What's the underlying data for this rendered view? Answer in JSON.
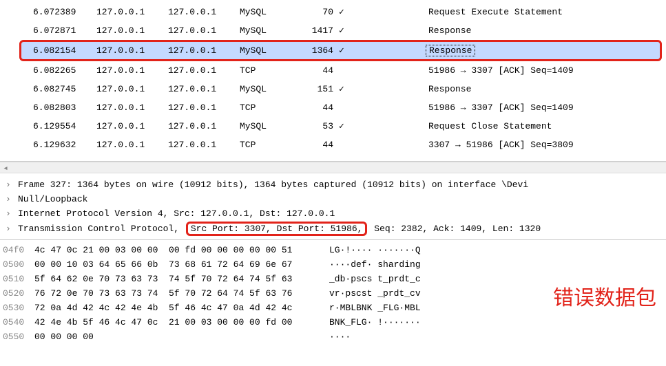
{
  "packets": [
    {
      "time": "6.072389",
      "src": "127.0.0.1",
      "dst": "127.0.0.1",
      "proto": "MySQL",
      "len": "70",
      "check": "✓",
      "info": "Request Execute Statement",
      "highlight": false
    },
    {
      "time": "6.072871",
      "src": "127.0.0.1",
      "dst": "127.0.0.1",
      "proto": "MySQL",
      "len": "1417",
      "check": "✓",
      "info": "Response",
      "highlight": false
    },
    {
      "time": "6.082154",
      "src": "127.0.0.1",
      "dst": "127.0.0.1",
      "proto": "MySQL",
      "len": "1364",
      "check": "✓",
      "info": "Response",
      "highlight": true
    },
    {
      "time": "6.082265",
      "src": "127.0.0.1",
      "dst": "127.0.0.1",
      "proto": "TCP",
      "len": "44",
      "check": "",
      "info": "51986 → 3307 [ACK] Seq=1409",
      "highlight": false
    },
    {
      "time": "6.082745",
      "src": "127.0.0.1",
      "dst": "127.0.0.1",
      "proto": "MySQL",
      "len": "151",
      "check": "✓",
      "info": "Response",
      "highlight": false
    },
    {
      "time": "6.082803",
      "src": "127.0.0.1",
      "dst": "127.0.0.1",
      "proto": "TCP",
      "len": "44",
      "check": "",
      "info": "51986 → 3307 [ACK] Seq=1409",
      "highlight": false
    },
    {
      "time": "6.129554",
      "src": "127.0.0.1",
      "dst": "127.0.0.1",
      "proto": "MySQL",
      "len": "53",
      "check": "✓",
      "info": "Request Close Statement",
      "highlight": false
    },
    {
      "time": "6.129632",
      "src": "127.0.0.1",
      "dst": "127.0.0.1",
      "proto": "TCP",
      "len": "44",
      "check": "",
      "info": "3307 → 51986 [ACK] Seq=3809",
      "highlight": false
    }
  ],
  "details": {
    "frame": "Frame 327: 1364 bytes on wire (10912 bits), 1364 bytes captured (10912 bits) on interface \\Devi",
    "null": "Null/Loopback",
    "ip": "Internet Protocol Version 4, Src: 127.0.0.1, Dst: 127.0.0.1",
    "tcp_pre": "Transmission Control Protocol, ",
    "tcp_box": "Src Port: 3307, Dst Port: 51986,",
    "tcp_post": " Seq: 2382, Ack: 1409, Len: 1320"
  },
  "hex": [
    {
      "off": "04f0",
      "bytes": "4c 47 0c 21 00 03 00 00  00 fd 00 00 00 00 00 51",
      "ascii": "LG·!···· ·······Q"
    },
    {
      "off": "0500",
      "bytes": "00 00 10 03 64 65 66 0b  73 68 61 72 64 69 6e 67",
      "ascii": "····def· sharding"
    },
    {
      "off": "0510",
      "bytes": "5f 64 62 0e 70 73 63 73  74 5f 70 72 64 74 5f 63",
      "ascii": "_db·pscs t_prdt_c"
    },
    {
      "off": "0520",
      "bytes": "76 72 0e 70 73 63 73 74  5f 70 72 64 74 5f 63 76",
      "ascii": "vr·pscst _prdt_cv"
    },
    {
      "off": "0530",
      "bytes": "72 0a 4d 42 4c 42 4e 4b  5f 46 4c 47 0a 4d 42 4c",
      "ascii": "r·MBLBNK _FLG·MBL"
    },
    {
      "off": "0540",
      "bytes": "42 4e 4b 5f 46 4c 47 0c  21 00 03 00 00 00 fd 00",
      "ascii": "BNK_FLG· !·······"
    },
    {
      "off": "0550",
      "bytes": "00 00 00 00",
      "ascii": "····"
    }
  ],
  "annotation": "错误数据包"
}
